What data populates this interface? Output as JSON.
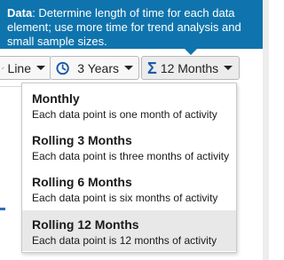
{
  "tooltip": {
    "title": "Data",
    "text": ": Determine length of time for each data element; use more time for trend analysis and small sample sizes."
  },
  "toolbar": {
    "chart_type_label": "Line",
    "range_label": "3 Years",
    "aggregation_label": "12 Months"
  },
  "dropdown": {
    "items": [
      {
        "title": "Monthly",
        "description": "Each data point is one month of activity"
      },
      {
        "title": "Rolling 3 Months",
        "description": "Each data point is three months of activity"
      },
      {
        "title": "Rolling 6 Months",
        "description": "Each data point is six months of activity"
      },
      {
        "title": "Rolling 12 Months",
        "description": "Each data point is 12 months of activity"
      }
    ],
    "selected": "Rolling 12 Months"
  },
  "colors": {
    "tooltip_bg": "#0f74ad",
    "accent_icon": "#1c5aa8",
    "selected_bg": "#e8e8e8"
  },
  "icons": {
    "chart_type": "line-chart-icon",
    "range": "clock-icon",
    "aggregation": "sigma-icon"
  }
}
